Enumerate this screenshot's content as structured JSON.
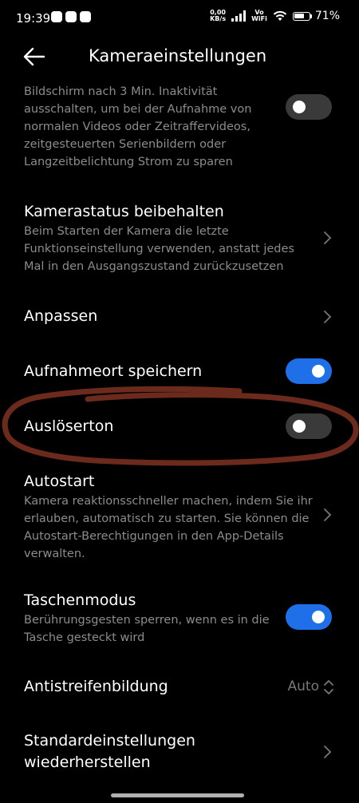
{
  "status_bar": {
    "time": "19:39",
    "net_speed_value": "0,00",
    "net_speed_unit": "KB/s",
    "vowifi_top": "Vo",
    "vowifi_bottom": "WiFi",
    "battery_percent": "71%",
    "battery_level": 0.71
  },
  "header": {
    "title": "Kameraeinstellungen",
    "back_icon": "arrow-left-icon"
  },
  "settings": {
    "power_saving": {
      "description": "Bildschirm nach 3 Min. Inaktivität ausschalten, um bei der Aufnahme von normalen Videos oder Zeitraffervideos, zeitgesteuerten Serienbildern oder Langzeitbelichtung Strom zu sparen",
      "enabled": false
    },
    "keep_camera_state": {
      "title": "Kamerastatus beibehalten",
      "description": "Beim Starten der Kamera die letzte Funktionseinstellung verwenden, anstatt jedes Mal in den Ausgangszustand zurückzusetzen"
    },
    "customize": {
      "title": "Anpassen"
    },
    "save_location": {
      "title": "Aufnahmeort speichern",
      "enabled": true
    },
    "shutter_sound": {
      "title": "Auslöserton",
      "enabled": false
    },
    "autostart": {
      "title": "Autostart",
      "description": "Kamera reaktionsschneller machen, indem Sie ihr erlauben, automatisch zu starten. Sie können die Autostart-Berechtigungen in den App-Details verwalten."
    },
    "pocket_mode": {
      "title": "Taschenmodus",
      "description": "Berührungsgesten sperren, wenn es in die Tasche gesteckt wird",
      "enabled": true
    },
    "anti_banding": {
      "title": "Antistreifenbildung",
      "value": "Auto"
    },
    "reset_defaults": {
      "title_line1": "Standardeinstellungen",
      "title_line2": "wiederherstellen"
    }
  },
  "colors": {
    "toggle_on": "#1f6fe8",
    "toggle_off": "#3a3a3a",
    "annotation": "#6b2a1c"
  }
}
